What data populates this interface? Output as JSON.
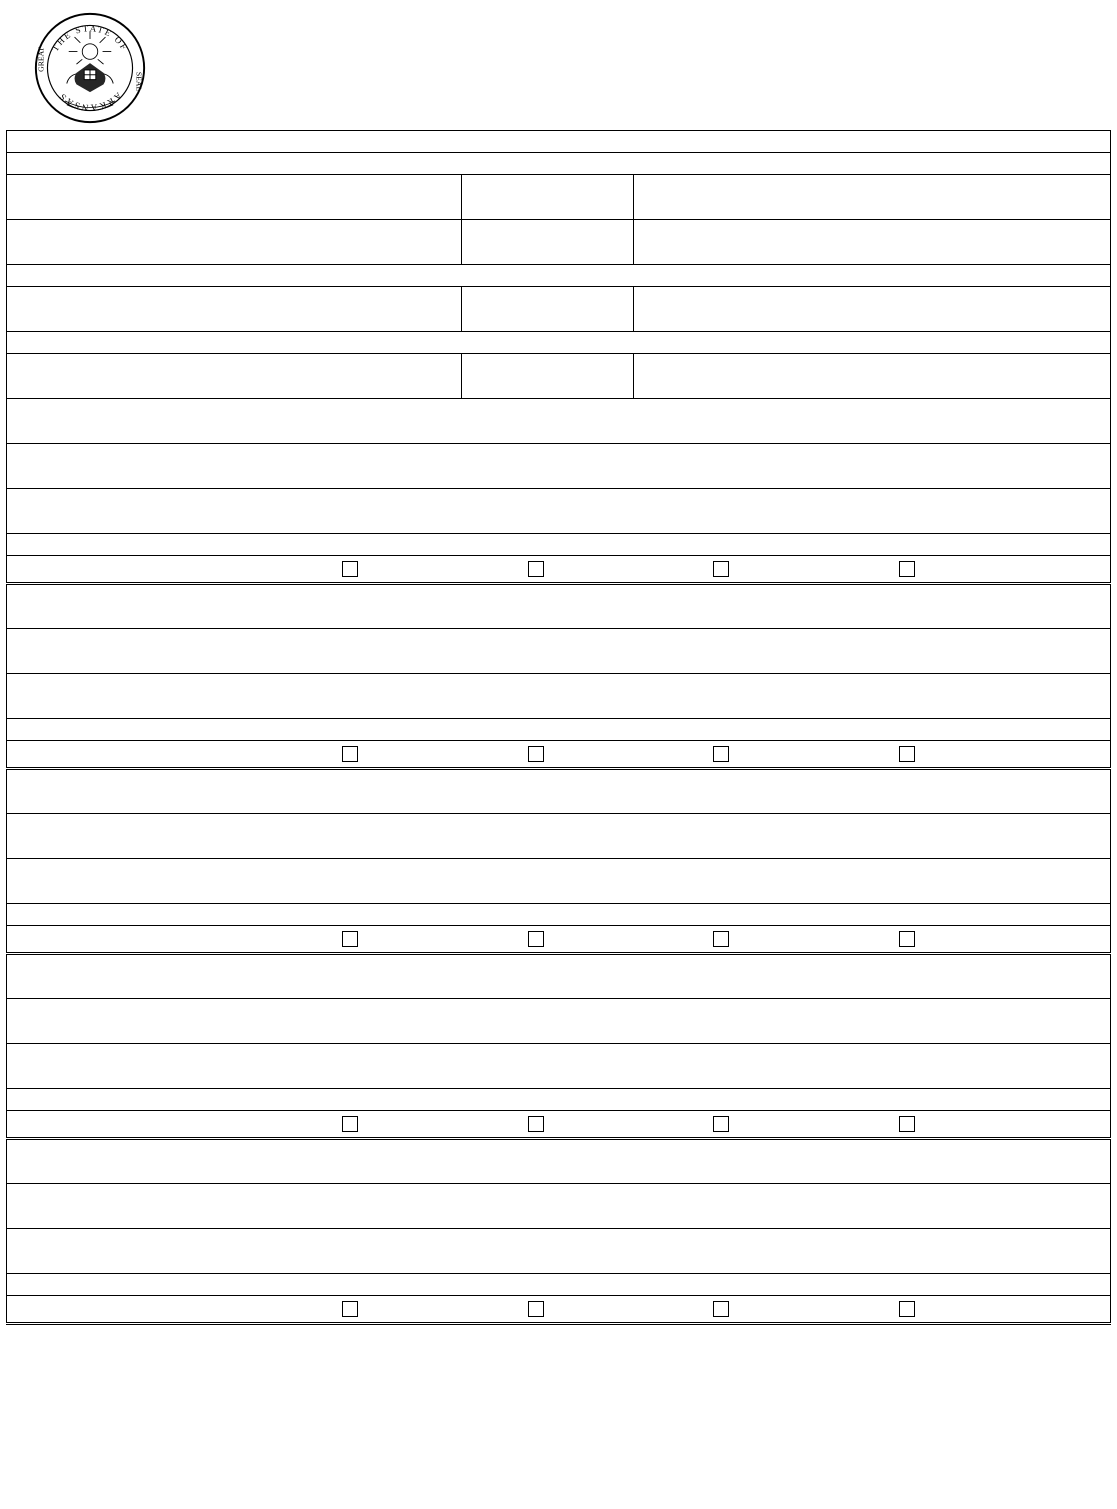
{
  "seal": {
    "alt": "Great Seal of the State of Arkansas"
  },
  "layout": {
    "col_widths": {
      "c1": 455,
      "c2": 172
    }
  },
  "top_rows": [
    {
      "type": "short",
      "cols": 1
    },
    {
      "type": "short",
      "cols": 1
    },
    {
      "type": "tall",
      "cols": 3
    },
    {
      "type": "tall",
      "cols": 3
    },
    {
      "type": "short",
      "cols": 1
    },
    {
      "type": "tall",
      "cols": 3
    },
    {
      "type": "short",
      "cols": 1
    },
    {
      "type": "tall",
      "cols": 3
    }
  ],
  "blocks": [
    {
      "rows": [
        {
          "type": "tall",
          "cols": 1
        },
        {
          "type": "tall",
          "cols": 1
        },
        {
          "type": "tall",
          "cols": 1
        },
        {
          "type": "short",
          "cols": 1
        }
      ],
      "checkboxes": [
        false,
        false,
        false,
        false
      ]
    },
    {
      "rows": [
        {
          "type": "tall",
          "cols": 1
        },
        {
          "type": "tall",
          "cols": 1
        },
        {
          "type": "tall",
          "cols": 1
        },
        {
          "type": "short",
          "cols": 1
        }
      ],
      "checkboxes": [
        false,
        false,
        false,
        false
      ]
    },
    {
      "rows": [
        {
          "type": "tall",
          "cols": 1
        },
        {
          "type": "tall",
          "cols": 1
        },
        {
          "type": "tall",
          "cols": 1
        },
        {
          "type": "short",
          "cols": 1
        }
      ],
      "checkboxes": [
        false,
        false,
        false,
        false
      ]
    },
    {
      "rows": [
        {
          "type": "tall",
          "cols": 1
        },
        {
          "type": "tall",
          "cols": 1
        },
        {
          "type": "tall",
          "cols": 1
        },
        {
          "type": "short",
          "cols": 1
        }
      ],
      "checkboxes": [
        false,
        false,
        false,
        false
      ]
    },
    {
      "rows": [
        {
          "type": "tall",
          "cols": 1
        },
        {
          "type": "tall",
          "cols": 1
        },
        {
          "type": "tall",
          "cols": 1
        },
        {
          "type": "short",
          "cols": 1
        }
      ],
      "checkboxes": [
        false,
        false,
        false,
        false
      ]
    }
  ]
}
